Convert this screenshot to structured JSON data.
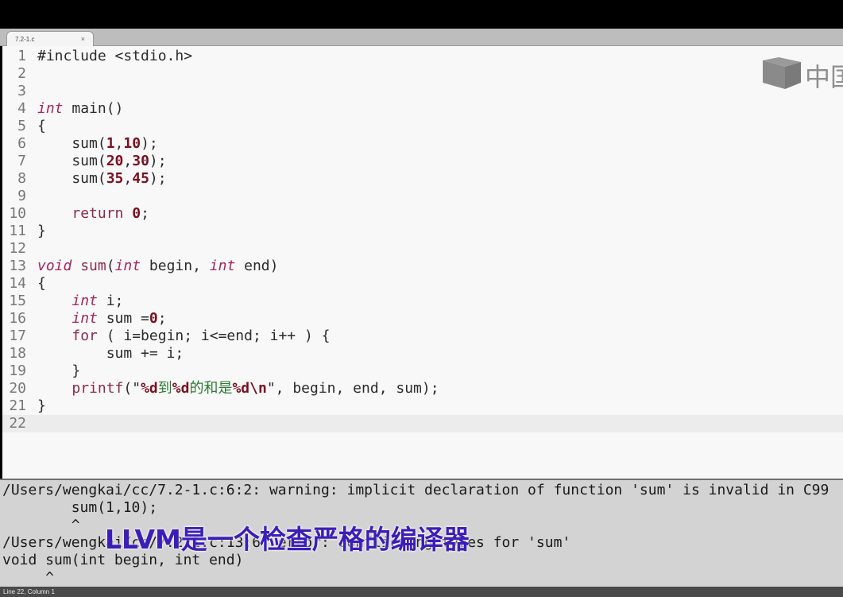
{
  "tab": {
    "title": "7.2-1.c",
    "close": "×"
  },
  "editor": {
    "lines": [
      {
        "n": "1",
        "tokens": [
          {
            "t": "#include <stdio.h>",
            "c": "txt"
          }
        ]
      },
      {
        "n": "2",
        "tokens": []
      },
      {
        "n": "3",
        "tokens": []
      },
      {
        "n": "4",
        "tokens": [
          {
            "t": "int",
            "c": "kw"
          },
          {
            "t": " main()",
            "c": "txt"
          }
        ]
      },
      {
        "n": "5",
        "tokens": [
          {
            "t": "{",
            "c": "txt"
          }
        ]
      },
      {
        "n": "6",
        "tokens": [
          {
            "t": "    sum(",
            "c": "txt"
          },
          {
            "t": "1",
            "c": "num"
          },
          {
            "t": ",",
            "c": "txt"
          },
          {
            "t": "10",
            "c": "num"
          },
          {
            "t": ");",
            "c": "txt"
          }
        ]
      },
      {
        "n": "7",
        "tokens": [
          {
            "t": "    sum(",
            "c": "txt"
          },
          {
            "t": "20",
            "c": "num"
          },
          {
            "t": ",",
            "c": "txt"
          },
          {
            "t": "30",
            "c": "num"
          },
          {
            "t": ");",
            "c": "txt"
          }
        ]
      },
      {
        "n": "8",
        "tokens": [
          {
            "t": "    sum(",
            "c": "txt"
          },
          {
            "t": "35",
            "c": "num"
          },
          {
            "t": ",",
            "c": "txt"
          },
          {
            "t": "45",
            "c": "num"
          },
          {
            "t": ");",
            "c": "txt"
          }
        ]
      },
      {
        "n": "9",
        "tokens": []
      },
      {
        "n": "10",
        "tokens": [
          {
            "t": "    ",
            "c": "txt"
          },
          {
            "t": "return",
            "c": "ctl"
          },
          {
            "t": " ",
            "c": "txt"
          },
          {
            "t": "0",
            "c": "num"
          },
          {
            "t": ";",
            "c": "txt"
          }
        ]
      },
      {
        "n": "11",
        "tokens": [
          {
            "t": "}",
            "c": "txt"
          }
        ]
      },
      {
        "n": "12",
        "tokens": []
      },
      {
        "n": "13",
        "tokens": [
          {
            "t": "void",
            "c": "kw"
          },
          {
            "t": " ",
            "c": "txt"
          },
          {
            "t": "sum",
            "c": "ctl"
          },
          {
            "t": "(",
            "c": "txt"
          },
          {
            "t": "int",
            "c": "kw"
          },
          {
            "t": " begin, ",
            "c": "txt"
          },
          {
            "t": "int",
            "c": "kw"
          },
          {
            "t": " end)",
            "c": "txt"
          }
        ]
      },
      {
        "n": "14",
        "tokens": [
          {
            "t": "{",
            "c": "txt"
          }
        ]
      },
      {
        "n": "15",
        "tokens": [
          {
            "t": "    ",
            "c": "txt"
          },
          {
            "t": "int",
            "c": "kw"
          },
          {
            "t": " i;",
            "c": "txt"
          }
        ]
      },
      {
        "n": "16",
        "tokens": [
          {
            "t": "    ",
            "c": "txt"
          },
          {
            "t": "int",
            "c": "kw"
          },
          {
            "t": " sum =",
            "c": "txt"
          },
          {
            "t": "0",
            "c": "num"
          },
          {
            "t": ";",
            "c": "txt"
          }
        ]
      },
      {
        "n": "17",
        "tokens": [
          {
            "t": "    ",
            "c": "txt"
          },
          {
            "t": "for",
            "c": "ctl"
          },
          {
            "t": " ( i=begin; i<=end; i++ ) {",
            "c": "txt"
          }
        ]
      },
      {
        "n": "18",
        "tokens": [
          {
            "t": "        sum += i;",
            "c": "txt"
          }
        ]
      },
      {
        "n": "19",
        "tokens": [
          {
            "t": "    }",
            "c": "txt"
          }
        ]
      },
      {
        "n": "20",
        "tokens": [
          {
            "t": "    ",
            "c": "txt"
          },
          {
            "t": "printf",
            "c": "ctl"
          },
          {
            "t": "(\"",
            "c": "txt"
          },
          {
            "t": "%d",
            "c": "esc"
          },
          {
            "t": "到",
            "c": "str"
          },
          {
            "t": "%d",
            "c": "esc"
          },
          {
            "t": "的和是",
            "c": "str"
          },
          {
            "t": "%d\\n",
            "c": "esc"
          },
          {
            "t": "\", begin, end, sum);",
            "c": "txt"
          }
        ]
      },
      {
        "n": "21",
        "tokens": [
          {
            "t": "}",
            "c": "txt"
          }
        ]
      },
      {
        "n": "22",
        "tokens": [],
        "current": true
      }
    ]
  },
  "logo": {
    "text": "中国"
  },
  "console": {
    "lines": [
      "/Users/wengkai/cc/7.2-1.c:6:2: warning: implicit declaration of function 'sum' is invalid in C99",
      "        sum(1,10);",
      "        ^",
      "/Users/wengkai/cc/7.2-1.c:13:6: error: conflicting types for 'sum'",
      "void sum(int begin, int end)",
      "     ^"
    ]
  },
  "subtitle": "LLVM是一个检查严格的编译器",
  "statusbar": {
    "text": "Line 22, Column 1"
  }
}
